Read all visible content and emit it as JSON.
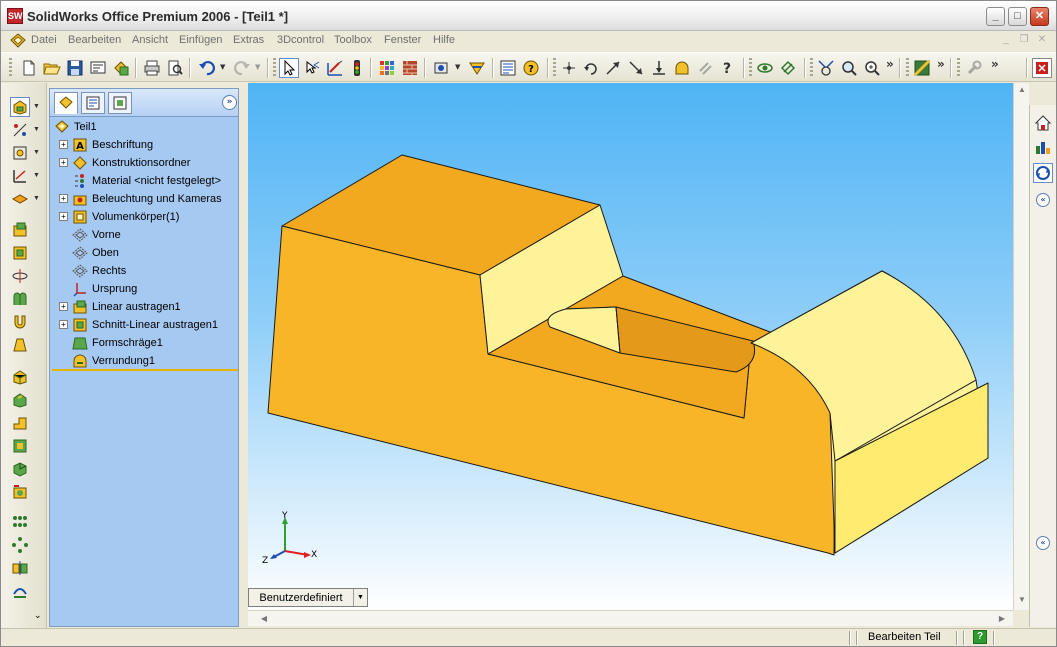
{
  "window": {
    "title": "SolidWorks Office Premium 2006 - [Teil1 *]",
    "app_icon_label": "SW"
  },
  "menu": {
    "items": [
      "Datei",
      "Bearbeiten",
      "Ansicht",
      "Einfügen",
      "Extras",
      "3Dcontrol",
      "Toolbox",
      "Fenster",
      "Hilfe"
    ]
  },
  "featuremanager": {
    "root": "Teil1",
    "nodes": [
      {
        "label": "Beschriftung",
        "expandable": true,
        "icon": "annotation-icon"
      },
      {
        "label": "Konstruktionsordner",
        "expandable": true,
        "icon": "design-binder-icon"
      },
      {
        "label": "Material <nicht festgelegt>",
        "expandable": false,
        "icon": "material-icon"
      },
      {
        "label": "Beleuchtung und Kameras",
        "expandable": true,
        "icon": "lighting-icon"
      },
      {
        "label": "Volumenkörper(1)",
        "expandable": true,
        "icon": "solid-bodies-icon"
      },
      {
        "label": "Vorne",
        "expandable": false,
        "icon": "plane-icon"
      },
      {
        "label": "Oben",
        "expandable": false,
        "icon": "plane-icon"
      },
      {
        "label": "Rechts",
        "expandable": false,
        "icon": "plane-icon"
      },
      {
        "label": "Ursprung",
        "expandable": false,
        "icon": "origin-icon"
      },
      {
        "label": "Linear austragen1",
        "expandable": true,
        "icon": "extrude-icon"
      },
      {
        "label": "Schnitt-Linear austragen1",
        "expandable": true,
        "icon": "cut-extrude-icon"
      },
      {
        "label": "Formschräge1",
        "expandable": false,
        "icon": "draft-icon"
      },
      {
        "label": "Verrundung1",
        "expandable": false,
        "icon": "fillet-icon"
      }
    ]
  },
  "viewport": {
    "view_orientation": "Benutzerdefiniert",
    "model_color": "#f9b528",
    "triad_axes": {
      "x": "X",
      "y": "Y",
      "z": "Z"
    }
  },
  "statusbar": {
    "mode": "Bearbeiten Teil",
    "help": "?"
  },
  "colors": {
    "background_top": "#4fb4f5",
    "background_bottom": "#ffffff",
    "featuremanager_bg": "#a6c9f2",
    "rollback_bar": "#e8b400"
  }
}
